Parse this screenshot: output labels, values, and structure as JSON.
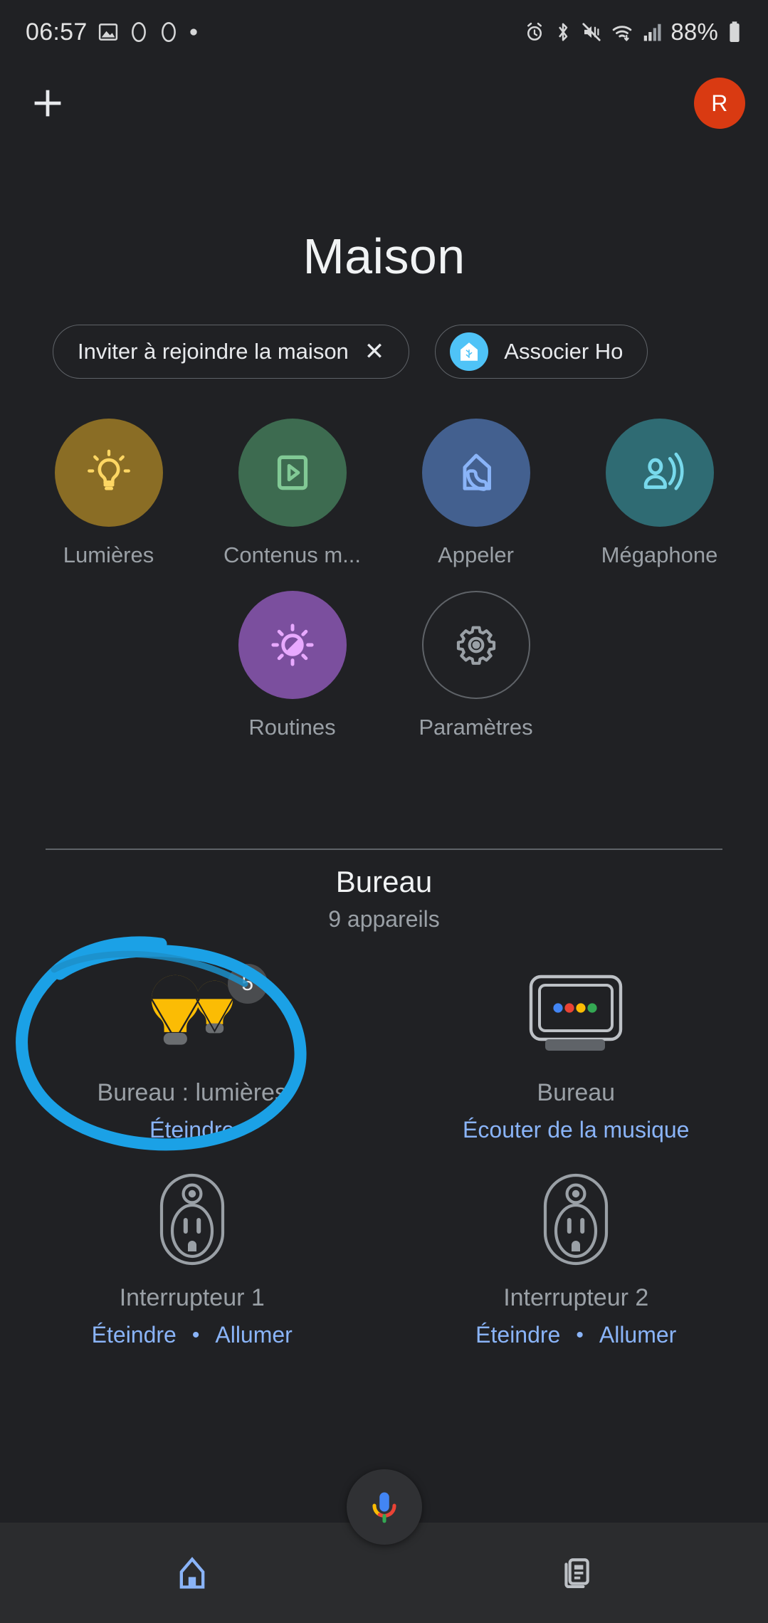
{
  "statusbar": {
    "time": "06:57",
    "battery_text": "88%",
    "left_icons": [
      "photo-icon",
      "circle-icon",
      "circle-icon",
      "dot-icon"
    ],
    "right_icons": [
      "alarm-icon",
      "bluetooth-icon",
      "mute-vibrate-icon",
      "wifi-icon",
      "cellular-signal-icon",
      "battery-icon"
    ]
  },
  "appbar": {
    "add_label": "+",
    "avatar_initial": "R"
  },
  "home": {
    "title": "Maison"
  },
  "chips": [
    {
      "label": "Inviter à rejoindre la maison",
      "close": "✕",
      "icon": null
    },
    {
      "label": "Associer Ho",
      "close": null,
      "icon": "smart-home-icon"
    }
  ],
  "quick_actions": [
    {
      "label": "Lumières",
      "icon": "lightbulb-icon",
      "bg": "#8a6d25",
      "fg": "#fdd663"
    },
    {
      "label": "Contenus m...",
      "icon": "media-play-icon",
      "bg": "#3d6b50",
      "fg": "#81c995"
    },
    {
      "label": "Appeler",
      "icon": "home-phone-icon",
      "bg": "#43608f",
      "fg": "#8ab4f8"
    },
    {
      "label": "Mégaphone",
      "icon": "broadcast-icon",
      "bg": "#2f6b73",
      "fg": "#78d9ec"
    },
    {
      "label": "Routines",
      "icon": "routines-icon",
      "bg": "#7b4f9e",
      "fg": "#e8a9ff"
    },
    {
      "label": "Paramètres",
      "icon": "gear-icon",
      "bg": "transparent",
      "fg": "#9aa0a6"
    }
  ],
  "room": {
    "name": "Bureau",
    "device_count": "9 appareils"
  },
  "devices": [
    {
      "name": "Bureau : lumières",
      "icon": "two-bulbs-icon",
      "badge": "5",
      "actions": [
        "Éteindre"
      ]
    },
    {
      "name": "Bureau",
      "icon": "nest-hub-icon",
      "badge": null,
      "actions": [
        "Écouter de la musique"
      ]
    },
    {
      "name": "Interrupteur 1",
      "icon": "outlet-icon",
      "badge": null,
      "actions": [
        "Éteindre",
        "Allumer"
      ]
    },
    {
      "name": "Interrupteur 2",
      "icon": "outlet-icon",
      "badge": null,
      "actions": [
        "Éteindre",
        "Allumer"
      ]
    }
  ],
  "annotation": {
    "shape": "hand-drawn-circle",
    "color": "#1ba1e6",
    "targets": "Bureau : lumières"
  },
  "fab": {
    "icon": "google-assistant-mic-icon"
  },
  "bottom_nav": [
    {
      "icon": "home-icon",
      "active": true
    },
    {
      "icon": "feed-icon",
      "active": false
    }
  ],
  "colors": {
    "background": "#202124",
    "accent_link": "#8ab4f8",
    "avatar": "#d93a12",
    "annotation": "#1ba1e6"
  }
}
